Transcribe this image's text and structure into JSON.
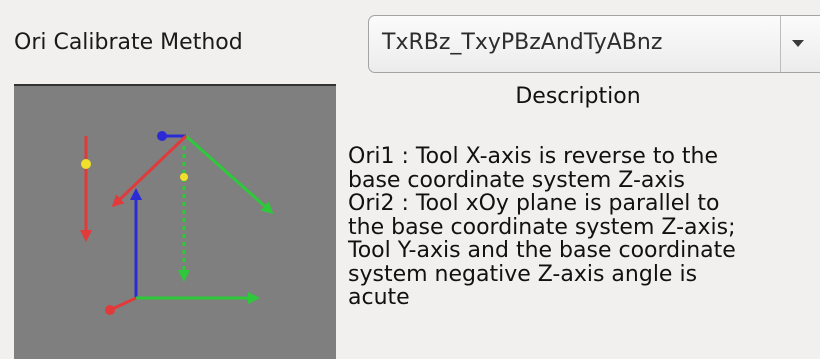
{
  "method": {
    "label": "Ori Calibrate Method",
    "selected": "TxRBz_TxyPBzAndTyABnz"
  },
  "description": {
    "heading": "Description",
    "lines": [
      "Ori1 : Tool X-axis is reverse to the",
      "base coordinate system Z-axis",
      "Ori2 : Tool xOy plane is parallel to",
      "the base coordinate system Z-axis;",
      "Tool Y-axis and the base coordinate",
      "system negative Z-axis angle is",
      "acute"
    ]
  },
  "preview": {
    "icon": "axes-diagram-icon",
    "colors": {
      "background": "#7f7f7f",
      "x_axis": "#e03a3a",
      "y_axis": "#2ec93a",
      "z_axis": "#2b2bd6",
      "marker": "#f0e02a"
    }
  }
}
